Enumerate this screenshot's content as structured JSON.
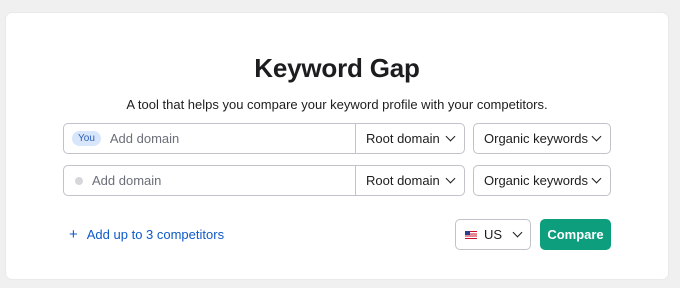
{
  "header": {
    "title": "Keyword Gap",
    "subtitle": "A tool that helps you compare your keyword profile with your competitors."
  },
  "rows": [
    {
      "badge": "You",
      "placeholder": "Add domain",
      "scope": "Root domain",
      "keyword_type": "Organic keywords"
    },
    {
      "placeholder": "Add domain",
      "scope": "Root domain",
      "keyword_type": "Organic keywords"
    }
  ],
  "footer": {
    "add_competitors": "Add up to 3 competitors",
    "country": "US",
    "country_flag_icon": "us-flag-icon",
    "compare": "Compare"
  },
  "colors": {
    "accent": "#0c9e7d",
    "link": "#0f5ac9",
    "badge_bg": "#d7e6fb"
  }
}
